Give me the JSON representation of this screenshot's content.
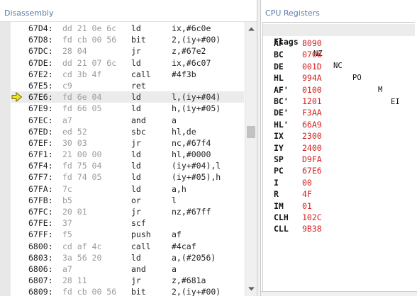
{
  "disassembly": {
    "title": "Disassembly",
    "rows": [
      {
        "addr": "67D4:",
        "bytes": "dd 21 0e 6c",
        "mnem": "ld",
        "ops": "ix,#6c0e",
        "current": false
      },
      {
        "addr": "67D8:",
        "bytes": "fd cb 00 56",
        "mnem": "bit",
        "ops": "2,(iy+#00)",
        "current": false
      },
      {
        "addr": "67DC:",
        "bytes": "28 04",
        "mnem": "jr",
        "ops": "z,#67e2",
        "current": false
      },
      {
        "addr": "67DE:",
        "bytes": "dd 21 07 6c",
        "mnem": "ld",
        "ops": "ix,#6c07",
        "current": false
      },
      {
        "addr": "67E2:",
        "bytes": "cd 3b 4f",
        "mnem": "call",
        "ops": "#4f3b",
        "current": false
      },
      {
        "addr": "67E5:",
        "bytes": "c9",
        "mnem": "ret",
        "ops": "",
        "current": false
      },
      {
        "addr": "67E6:",
        "bytes": "fd 6e 04",
        "mnem": "ld",
        "ops": "l,(iy+#04)",
        "current": true
      },
      {
        "addr": "67E9:",
        "bytes": "fd 66 05",
        "mnem": "ld",
        "ops": "h,(iy+#05)",
        "current": false
      },
      {
        "addr": "67EC:",
        "bytes": "a7",
        "mnem": "and",
        "ops": "a",
        "current": false
      },
      {
        "addr": "67ED:",
        "bytes": "ed 52",
        "mnem": "sbc",
        "ops": "hl,de",
        "current": false
      },
      {
        "addr": "67EF:",
        "bytes": "30 03",
        "mnem": "jr",
        "ops": "nc,#67f4",
        "current": false
      },
      {
        "addr": "67F1:",
        "bytes": "21 00 00",
        "mnem": "ld",
        "ops": "hl,#0000",
        "current": false
      },
      {
        "addr": "67F4:",
        "bytes": "fd 75 04",
        "mnem": "ld",
        "ops": "(iy+#04),l",
        "current": false
      },
      {
        "addr": "67F7:",
        "bytes": "fd 74 05",
        "mnem": "ld",
        "ops": "(iy+#05),h",
        "current": false
      },
      {
        "addr": "67FA:",
        "bytes": "7c",
        "mnem": "ld",
        "ops": "a,h",
        "current": false
      },
      {
        "addr": "67FB:",
        "bytes": "b5",
        "mnem": "or",
        "ops": "l",
        "current": false
      },
      {
        "addr": "67FC:",
        "bytes": "20 01",
        "mnem": "jr",
        "ops": "nz,#67ff",
        "current": false
      },
      {
        "addr": "67FE:",
        "bytes": "37",
        "mnem": "scf",
        "ops": "",
        "current": false
      },
      {
        "addr": "67FF:",
        "bytes": "f5",
        "mnem": "push",
        "ops": "af",
        "current": false
      },
      {
        "addr": "6800:",
        "bytes": "cd af 4c",
        "mnem": "call",
        "ops": "#4caf",
        "current": false
      },
      {
        "addr": "6803:",
        "bytes": "3a 56 20",
        "mnem": "ld",
        "ops": "a,(#2056)",
        "current": false
      },
      {
        "addr": "6806:",
        "bytes": "a7",
        "mnem": "and",
        "ops": "a",
        "current": false
      },
      {
        "addr": "6807:",
        "bytes": "28 11",
        "mnem": "jr",
        "ops": "z,#681a",
        "current": false
      },
      {
        "addr": "6809:",
        "bytes": "fd cb 00 56",
        "mnem": "bit",
        "ops": "2,(iy+#00)",
        "current": false
      }
    ],
    "current_marker_icon": "current-instruction-arrow-icon",
    "scroll_up_icon": "scroll-up-arrow-icon",
    "scroll_down_icon": "scroll-down-arrow-icon"
  },
  "cpu": {
    "title": "CPU Registers",
    "flags_label": "Flags",
    "flags": [
      "NZ",
      "NC",
      "PO",
      "M",
      "EI"
    ],
    "registers": [
      {
        "name": "AF",
        "value": "8090"
      },
      {
        "name": "BC",
        "value": "0706"
      },
      {
        "name": "DE",
        "value": "001D"
      },
      {
        "name": "HL",
        "value": "994A"
      },
      {
        "name": "AF'",
        "value": "0100"
      },
      {
        "name": "BC'",
        "value": "1201"
      },
      {
        "name": "DE'",
        "value": "F3AA"
      },
      {
        "name": "HL'",
        "value": "66A9"
      },
      {
        "name": "IX",
        "value": "2300"
      },
      {
        "name": "IY",
        "value": "2400"
      },
      {
        "name": "SP",
        "value": "D9FA"
      },
      {
        "name": "PC",
        "value": "67E6"
      },
      {
        "name": "I",
        "value": "00"
      },
      {
        "name": "R",
        "value": "4F"
      },
      {
        "name": "IM",
        "value": "01"
      },
      {
        "name": "CLH",
        "value": "102C"
      },
      {
        "name": "CLL",
        "value": "9B38"
      }
    ],
    "value_color": "#d42020"
  }
}
